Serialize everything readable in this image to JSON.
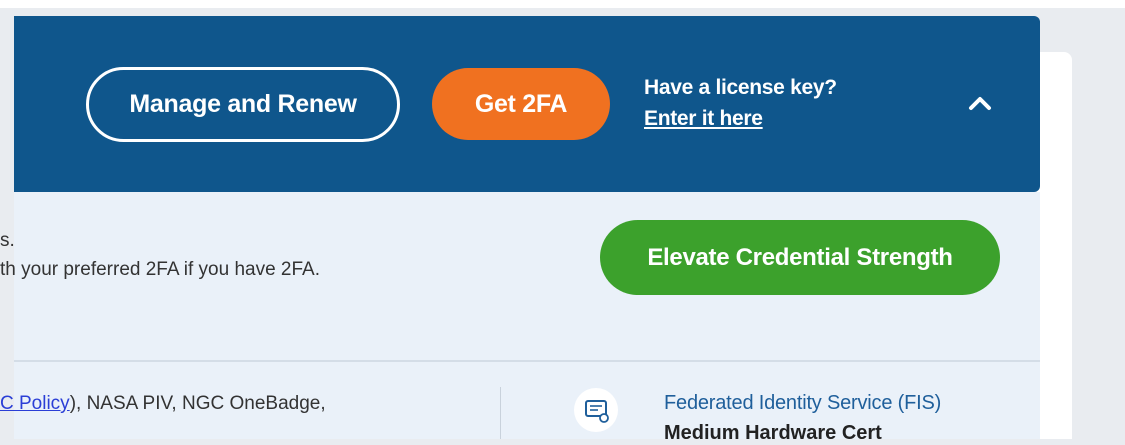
{
  "banner": {
    "manage_button": "Manage and Renew",
    "get2fa_button": "Get 2FA",
    "license_question": "Have a license key?",
    "license_link": "Enter it here",
    "collapse_icon": "chevron-up-icon"
  },
  "panel": {
    "line1": "s.",
    "line2": "th your preferred 2FA if you have 2FA.",
    "elevate_button": "Elevate Credential Strength"
  },
  "credentials": {
    "policy_link": "C Policy",
    "policy_rest": "), NASA PIV, NGC OneBadge,",
    "cert_icon": "certificate-icon",
    "cert_title": "Federated Identity Service (FIS)",
    "cert_subtitle": "Medium Hardware Cert"
  },
  "colors": {
    "banner_bg": "#0f568c",
    "get2fa_bg": "#f07120",
    "elevate_bg": "#3ca12c",
    "panel_bg": "#eaf1f9",
    "link": "#2a3ed6"
  }
}
